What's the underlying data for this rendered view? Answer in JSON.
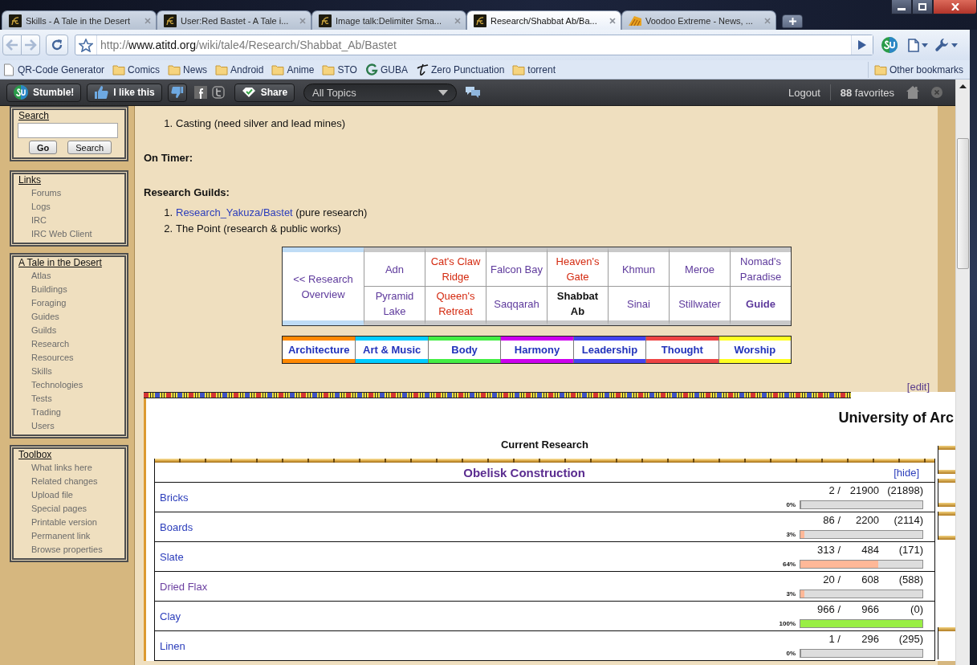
{
  "browser": {
    "tabs": [
      {
        "title": "Skills - A Tale in the Desert",
        "kind": "emblem",
        "selected": false
      },
      {
        "title": "User:Red Bastet - A Tale i...",
        "kind": "emblem",
        "selected": false
      },
      {
        "title": "Image talk:Delimiter Sma...",
        "kind": "emblem",
        "selected": false
      },
      {
        "title": "Research/Shabbat Ab/Ba...",
        "kind": "emblem",
        "selected": true
      },
      {
        "title": "Voodoo Extreme - News, ...",
        "kind": "wedge",
        "selected": false
      }
    ],
    "url": {
      "scheme": "http://",
      "host": "www.atitd.org",
      "path": "/wiki/tale4/Research/Shabbat_Ab/Bastet"
    },
    "bookmarks": [
      {
        "label": "QR-Code Generator",
        "kind": "page"
      },
      {
        "label": "Comics",
        "kind": "folder"
      },
      {
        "label": "News",
        "kind": "folder"
      },
      {
        "label": "Android",
        "kind": "folder"
      },
      {
        "label": "Anime",
        "kind": "folder"
      },
      {
        "label": "STO",
        "kind": "folder"
      },
      {
        "label": "GUBA",
        "kind": "g"
      },
      {
        "label": "Zero Punctuation",
        "kind": "script"
      },
      {
        "label": "torrent",
        "kind": "folder"
      }
    ],
    "other_bookmarks": "Other bookmarks"
  },
  "stumble_bar": {
    "stumble": "Stumble!",
    "like": "I like this",
    "share": "Share",
    "topics": "All Topics",
    "logout": "Logout",
    "favorites": "**88** favorites"
  },
  "sidebar": {
    "search": {
      "heading": "Search",
      "buttons": [
        {
          "label": "Go",
          "default": true
        },
        {
          "label": "Search",
          "default": false
        }
      ]
    },
    "portlets": [
      {
        "heading": "Links",
        "items": [
          "Forums",
          "Logs",
          "IRC",
          "IRC Web Client"
        ]
      },
      {
        "heading": "A Tale in the Desert",
        "items": [
          "Atlas",
          "Buildings",
          "Foraging",
          "Guides",
          "Guilds",
          "Research",
          "Resources",
          "Skills",
          "Technologies",
          "Tests",
          "Trading",
          "Users"
        ]
      },
      {
        "heading": "Toolbox",
        "items": [
          "What links here",
          "Related changes",
          "Upload file",
          "Special pages",
          "Printable version",
          "Permanent link",
          "Browse properties"
        ]
      }
    ]
  },
  "content": {
    "priorities": [
      {
        "number": "1.",
        "text": "Casting (need silver and lead mines)"
      }
    ],
    "on_timer": "On Timer:",
    "guilds_heading": "Research Guilds:",
    "guilds": [
      {
        "number": "1.",
        "link": "Research_Yakuza/Bastet",
        "text": "(pure research)"
      },
      {
        "number": "2.",
        "text": "The Point (research & public works)"
      }
    ],
    "region_nav": {
      "overview": {
        "label": "<< Research Overview",
        "kind": "visited",
        "bold": false
      },
      "rows": [
        [
          {
            "label": "Adn",
            "kind": "visited",
            "bold": false
          },
          {
            "label": "Cat's Claw Ridge",
            "kind": "redlink",
            "bold": false
          },
          {
            "label": "Falcon Bay",
            "kind": "visited",
            "bold": false
          },
          {
            "label": "Heaven's Gate",
            "kind": "redlink",
            "bold": false
          },
          {
            "label": "Khmun",
            "kind": "visited",
            "bold": false
          },
          {
            "label": "Meroe",
            "kind": "visited",
            "bold": false
          },
          {
            "label": "Nomad's Paradise",
            "kind": "visited",
            "bold": false
          }
        ],
        [
          {
            "label": "Pyramid Lake",
            "kind": "visited",
            "bold": false
          },
          {
            "label": "Queen's Retreat",
            "kind": "redlink",
            "bold": false
          },
          {
            "label": "Saqqarah",
            "kind": "visited",
            "bold": false
          },
          {
            "label": "Shabbat Ab",
            "kind": "current",
            "bold": true
          },
          {
            "label": "Sinai",
            "kind": "visited",
            "bold": false
          },
          {
            "label": "Stillwater",
            "kind": "visited",
            "bold": false
          },
          {
            "label": "Guide",
            "kind": "visited",
            "bold": true
          }
        ]
      ]
    },
    "categories": [
      {
        "label": "Architecture",
        "color": "#ff8800"
      },
      {
        "label": "Art & Music",
        "color": "#00ccff"
      },
      {
        "label": "Body",
        "color": "#44ee44"
      },
      {
        "label": "Harmony",
        "color": "#cc00ee"
      },
      {
        "label": "Leadership",
        "color": "#4444ee"
      },
      {
        "label": "Thought",
        "color": "#ee4444"
      },
      {
        "label": "Worship",
        "color": "#ffff22"
      }
    ],
    "edit": "[edit]"
  },
  "university": {
    "title": "University of Arc",
    "subtitle": "Current Research",
    "project": {
      "title": "Obelisk Construction",
      "toggle": "[hide]",
      "rows": [
        {
          "name": "Bricks",
          "visited": false,
          "have": "2 /",
          "need": "21900",
          "remaining": "(21898)",
          "percent": "0%",
          "level": 0
        },
        {
          "name": "Boards",
          "visited": false,
          "have": "86 /",
          "need": "2200",
          "remaining": "(2114)",
          "percent": "3%",
          "level": 0.03
        },
        {
          "name": "Slate",
          "visited": false,
          "have": "313 /",
          "need": "484",
          "remaining": "(171)",
          "percent": "64%",
          "level": 0.64
        },
        {
          "name": "Dried Flax",
          "visited": true,
          "have": "20 /",
          "need": "608",
          "remaining": "(588)",
          "percent": "3%",
          "level": 0.03
        },
        {
          "name": "Clay",
          "visited": false,
          "have": "966 /",
          "need": "966",
          "remaining": "(0)",
          "percent": "100%",
          "level": 1
        },
        {
          "name": "Linen",
          "visited": false,
          "have": "1 /",
          "need": "296",
          "remaining": "(295)",
          "percent": "0%",
          "level": 0
        }
      ]
    }
  }
}
